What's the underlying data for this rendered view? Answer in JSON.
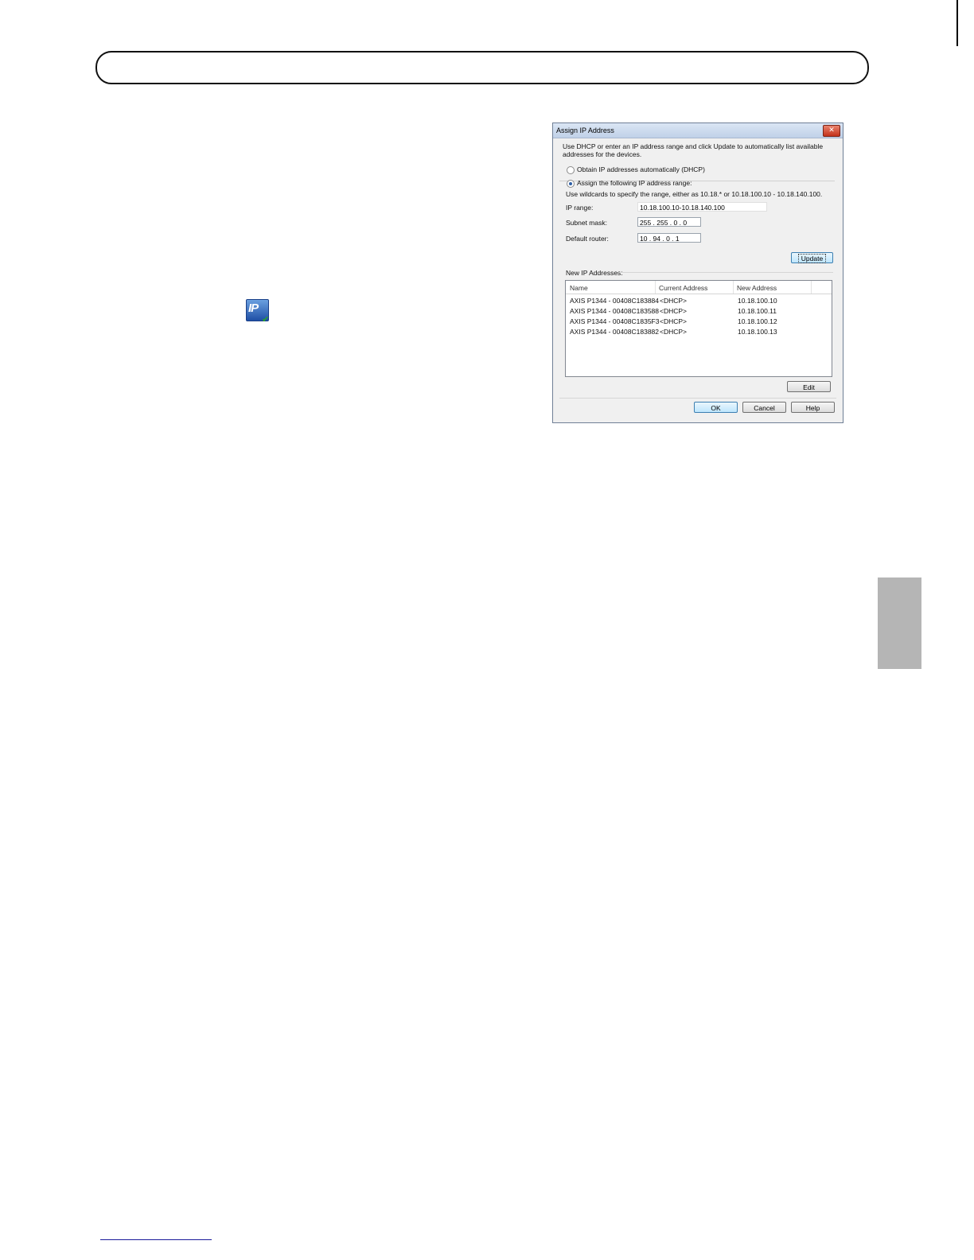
{
  "dialog": {
    "title": "Assign IP Address",
    "close_glyph": "✕",
    "intro": "Use DHCP or enter an IP address range and click Update to automatically list available addresses for the devices.",
    "option_dhcp": "Obtain IP addresses automatically (DHCP)",
    "option_range": "Assign the following IP address range:",
    "selected_option": "range",
    "wildcard_hint": "Use wildcards to specify the range, either as 10.18.* or 10.18.100.10 - 10.18.140.100.",
    "ip_range_label": "IP range:",
    "ip_range_value": "10.18.100.10-10.18.140.100",
    "subnet_label": "Subnet mask:",
    "subnet_value": "255 . 255 .  0  .  0",
    "router_label": "Default router:",
    "router_value": " 10 .  94 .  0  .  1",
    "update_button": "Update",
    "new_ip_label": "New IP Addresses:",
    "columns": [
      "Name",
      "Current Address",
      "New Address"
    ],
    "rows": [
      {
        "name": "AXIS P1344 - 00408C183884",
        "current": "<DHCP>",
        "new": "10.18.100.10"
      },
      {
        "name": "AXIS P1344 - 00408C183588",
        "current": "<DHCP>",
        "new": "10.18.100.11"
      },
      {
        "name": "AXIS P1344 - 00408C1835F3",
        "current": "<DHCP>",
        "new": "10.18.100.12"
      },
      {
        "name": "AXIS P1344 - 00408C183882",
        "current": "<DHCP>",
        "new": "10.18.100.13"
      }
    ],
    "edit_button": "Edit",
    "ok_button": "OK",
    "cancel_button": "Cancel",
    "help_button": "Help"
  },
  "icon": {
    "name": "ip-utility-icon",
    "label": "IP"
  },
  "colors": {
    "side_tab": "#b5b5b5",
    "title_bar": "#c0d1e8"
  }
}
